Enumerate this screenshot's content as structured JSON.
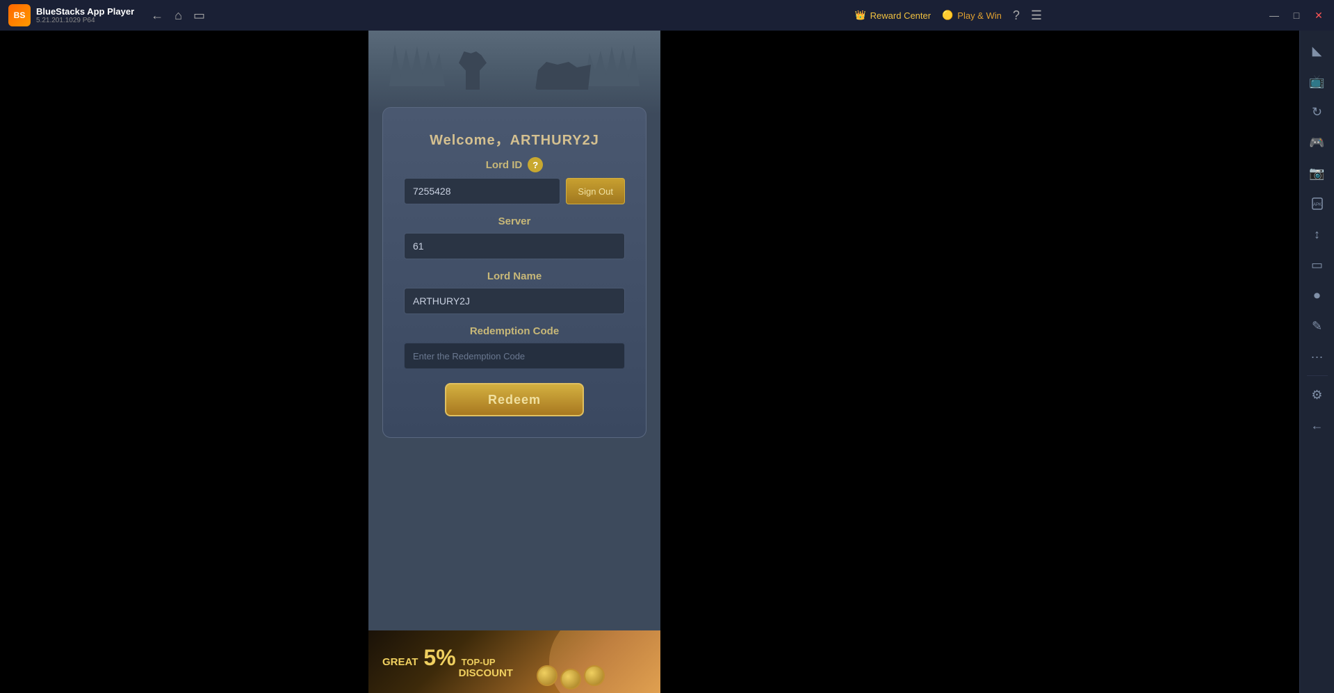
{
  "titleBar": {
    "appName": "BlueStacks App Player",
    "version": "5.21.201.1029  P64",
    "logoText": "BS",
    "nav": {
      "back": "←",
      "home": "⌂",
      "multi": "⧉"
    },
    "rewardCenter": "Reward Center",
    "playWin": "Play & Win",
    "helpIcon": "?",
    "menuIcon": "☰",
    "minimizeIcon": "—",
    "maximizeIcon": "□",
    "closeIcon": "✕"
  },
  "dialog": {
    "welcomeText": "Welcome，ARTHURY2J",
    "lordIdLabel": "Lord ID",
    "lordIdValue": "7255428",
    "signOutLabel": "Sign Out",
    "serverLabel": "Server",
    "serverValue": "61",
    "lordNameLabel": "Lord Name",
    "lordNameValue": "ARTHURY2J",
    "redemptionCodeLabel": "Redemption Code",
    "redemptionCodePlaceholder": "Enter the Redemption Code",
    "redeemLabel": "Redeem"
  },
  "banner": {
    "greatValue": "GREAT",
    "percentage": "5%",
    "topUp": "TOP-UP",
    "discount": "DISCOUNT"
  },
  "sidebar": {
    "icons": [
      {
        "name": "settings-icon",
        "symbol": "⚙",
        "interactable": true
      },
      {
        "name": "display-icon",
        "symbol": "🖥",
        "interactable": true
      },
      {
        "name": "rotate-icon",
        "symbol": "↻",
        "interactable": true
      },
      {
        "name": "gamepad-icon",
        "symbol": "🎮",
        "interactable": true
      },
      {
        "name": "camera-icon",
        "symbol": "📷",
        "interactable": true
      },
      {
        "name": "apk-icon",
        "symbol": "📦",
        "interactable": true
      },
      {
        "name": "resize-icon",
        "symbol": "⤢",
        "interactable": true
      },
      {
        "name": "fullscreen-icon",
        "symbol": "⛶",
        "interactable": true
      },
      {
        "name": "macro-icon",
        "symbol": "⏺",
        "interactable": true
      },
      {
        "name": "script-icon",
        "symbol": "✎",
        "interactable": true
      },
      {
        "name": "more-icon",
        "symbol": "···",
        "interactable": true
      },
      {
        "name": "config-icon",
        "symbol": "⚙",
        "interactable": true
      },
      {
        "name": "back-icon",
        "symbol": "←",
        "interactable": true
      }
    ]
  }
}
